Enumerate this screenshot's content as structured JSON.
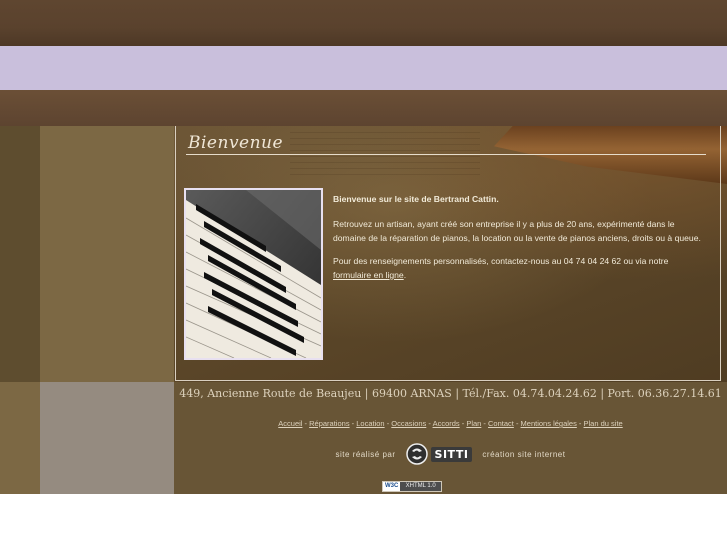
{
  "header": {
    "title": "Bienvenue"
  },
  "intro": {
    "lead": "Bienvenue sur le site de Bertrand Cattin.",
    "paragraph1": "Retrouvez un artisan, ayant créé son entreprise il y a plus de 20 ans, expérimenté dans le domaine de la réparation de pianos, la location ou la vente de pianos anciens, droits ou à queue.",
    "paragraph2_prefix": "Pour des renseignements personnalisés, contactez-nous au 04 74 04 24 62 ou via notre ",
    "contact_link": "formulaire en ligne",
    "paragraph2_suffix": "."
  },
  "footer": {
    "address": "449, Ancienne Route de Beaujeu | 69400 ARNAS | Tél./Fax. 04.74.04.24.62 | Port. 06.36.27.14.61",
    "nav": [
      {
        "label": "Accueil"
      },
      {
        "label": "Réparations"
      },
      {
        "label": "Location"
      },
      {
        "label": "Occasions"
      },
      {
        "label": "Accords"
      },
      {
        "label": "Plan"
      },
      {
        "label": "Contact"
      },
      {
        "label": "Mentions légales"
      },
      {
        "label": "Plan du site"
      }
    ],
    "nav_separator": " - ",
    "credit_prefix": "site réalisé par",
    "credit_logo": "SITTI",
    "credit_suffix": "création site internet",
    "badge_w3c": "W3C",
    "badge_label": "XHTML 1.0"
  },
  "icons": {
    "photo": "piano-keyboard-photo",
    "logo": "sitti-logo-icon"
  },
  "colors": {
    "lavender_band": "#c9bfdc",
    "panel_brown": "#5c4729",
    "text_cream": "#f1ead8"
  }
}
